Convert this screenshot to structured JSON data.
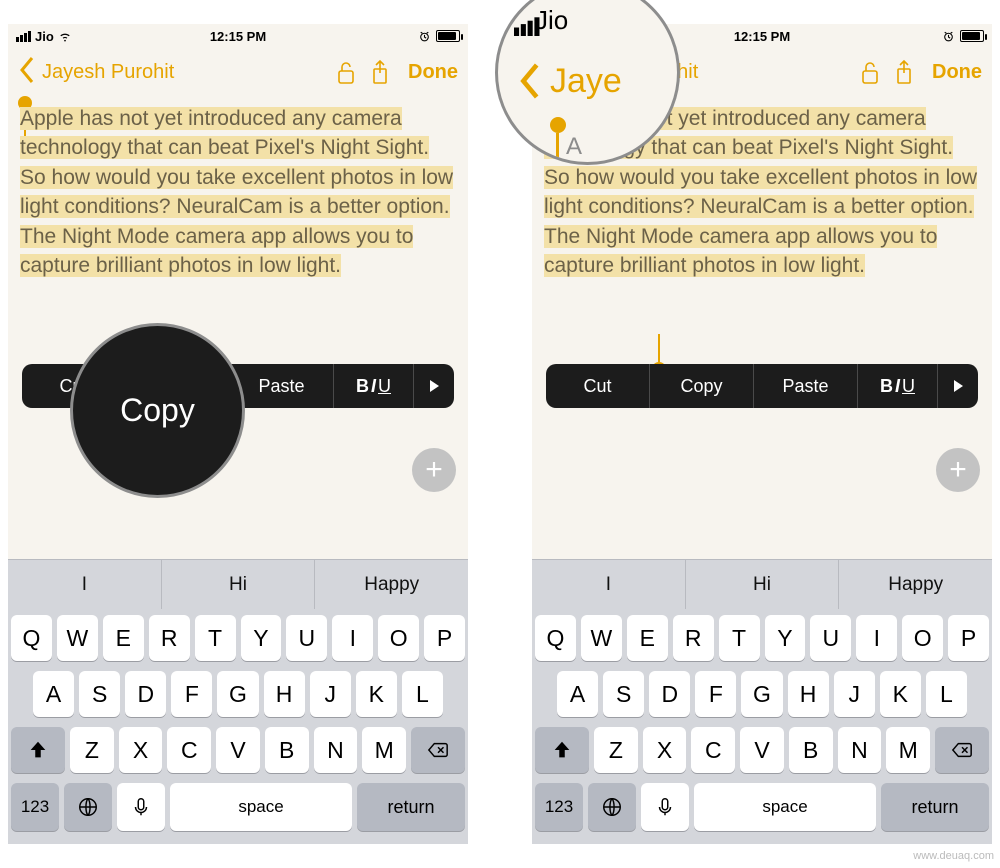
{
  "status": {
    "carrier": "Jio",
    "time": "12:15 PM"
  },
  "nav": {
    "back_label": "Jayesh Purohit",
    "done_label": "Done"
  },
  "note": {
    "text": "Apple has not yet introduced any camera technology that can beat Pixel's Night Sight. So how would you take excellent photos in low light conditions? NeuralCam is a better option. The Night Mode camera app allows you to capture brilliant photos in low light."
  },
  "edit_menu": {
    "cut": "Cut",
    "copy": "Copy",
    "paste": "Paste",
    "biu_b": "B",
    "biu_i": "I",
    "biu_u": "U"
  },
  "suggestions": [
    "I",
    "Hi",
    "Happy"
  ],
  "keyboard": {
    "row1": [
      "Q",
      "W",
      "E",
      "R",
      "T",
      "Y",
      "U",
      "I",
      "O",
      "P"
    ],
    "row2": [
      "A",
      "S",
      "D",
      "F",
      "G",
      "H",
      "J",
      "K",
      "L"
    ],
    "row3": [
      "Z",
      "X",
      "C",
      "V",
      "B",
      "N",
      "M"
    ],
    "numbers_label": "123",
    "space_label": "space",
    "return_label": "return"
  },
  "zoom_left": {
    "big_text": "Copy"
  },
  "zoom_right": {
    "carrier_big": "Jio",
    "back_big": "Jaye"
  },
  "watermark": "www.deuaq.com"
}
